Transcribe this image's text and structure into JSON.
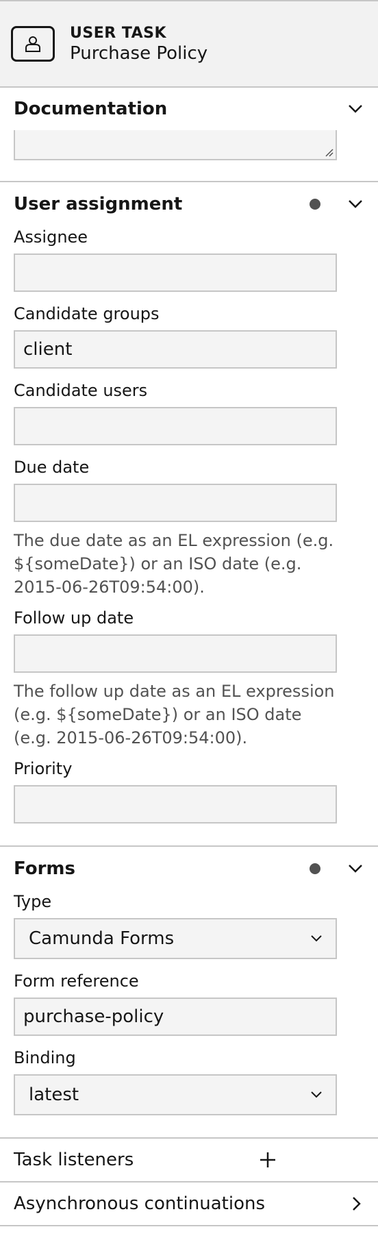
{
  "header": {
    "type": "USER TASK",
    "name": "Purchase Policy",
    "icon": "user-task-icon"
  },
  "documentation": {
    "title": "Documentation"
  },
  "user_assignment": {
    "title": "User assignment",
    "assignee": {
      "label": "Assignee",
      "value": ""
    },
    "candidate_groups": {
      "label": "Candidate groups",
      "value": "client"
    },
    "candidate_users": {
      "label": "Candidate users",
      "value": ""
    },
    "due_date": {
      "label": "Due date",
      "value": "",
      "hint": "The due date as an EL expression (e.g. ${someDate}) or an ISO date (e.g. 2015-06-26T09:54:00)."
    },
    "follow_up_date": {
      "label": "Follow up date",
      "value": "",
      "hint": "The follow up date as an EL expression (e.g. ${someDate}) or an ISO date (e.g. 2015-06-26T09:54:00)."
    },
    "priority": {
      "label": "Priority",
      "value": ""
    }
  },
  "forms": {
    "title": "Forms",
    "type": {
      "label": "Type",
      "value": "Camunda Forms"
    },
    "form_reference": {
      "label": "Form reference",
      "value": "purchase-policy"
    },
    "binding": {
      "label": "Binding",
      "value": "latest"
    }
  },
  "task_listeners": {
    "title": "Task listeners"
  },
  "async_continuations": {
    "title": "Asynchronous continuations"
  },
  "colors": {
    "header_bg": "#f2f2f2",
    "border": "#c6c6c6",
    "input_bg": "#f4f4f4",
    "dot": "#525252",
    "hint_text": "#525252"
  }
}
